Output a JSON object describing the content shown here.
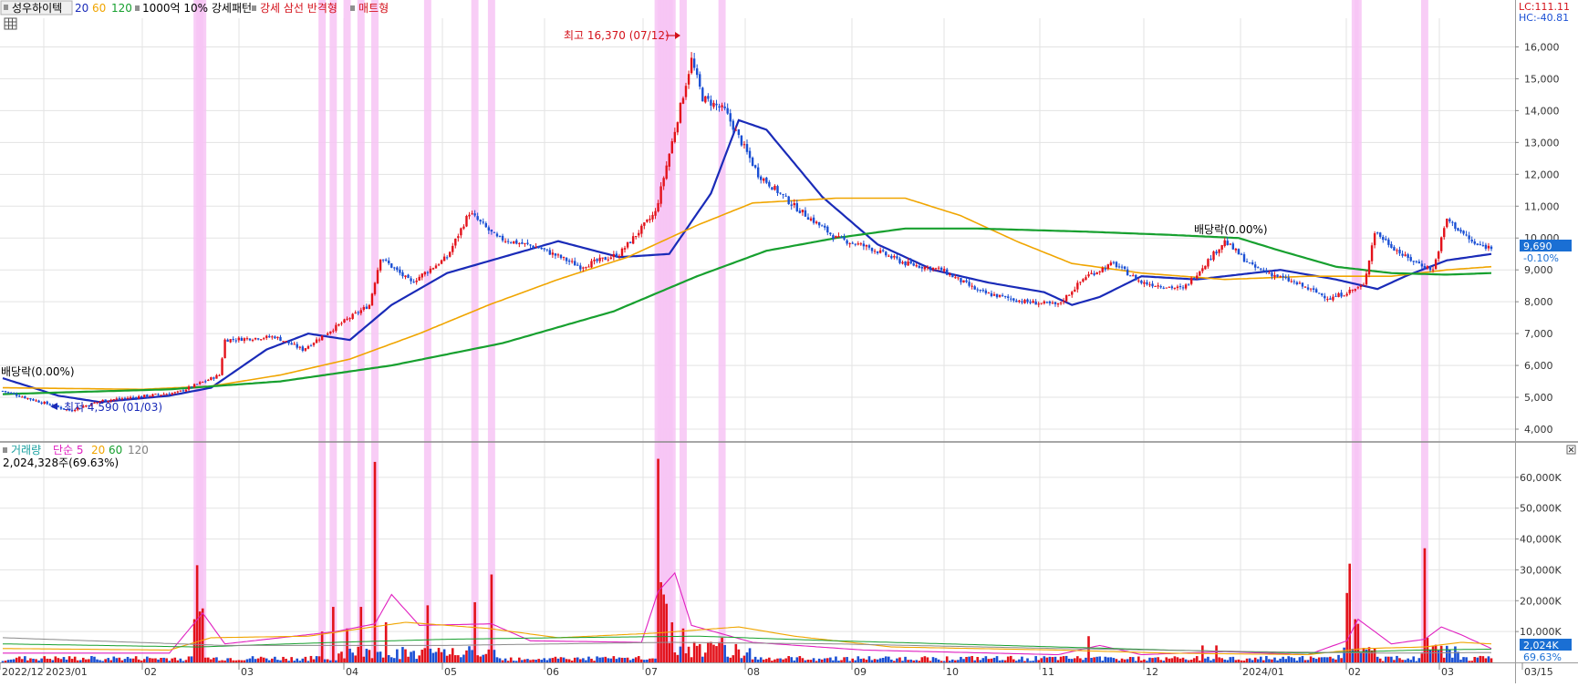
{
  "header": {
    "stock_name": "성우하이텍",
    "ma_labels": [
      {
        "label": "20",
        "color": "#1a2bb8"
      },
      {
        "label": "60",
        "color": "#f0a500"
      },
      {
        "label": "120",
        "color": "#17a02f"
      }
    ],
    "filter_text": "1000억 10% 강세패턴",
    "pattern_labels": [
      {
        "label": "강세 삼선 반격형",
        "color": "#d4121b"
      },
      {
        "label": "매트형",
        "color": "#d4121b"
      }
    ],
    "lc_text": "LC:111.11",
    "hc_text": "HC:-40.81"
  },
  "price_panel": {
    "current_price": "9,690",
    "change_pct": "-0.10%",
    "high_annotation": "최고 16,370 (07/12)",
    "low_annotation": "최저 4,590 (01/03)",
    "dividend_labels": [
      "배당락(0.00%)",
      "배당락(0.00%)"
    ]
  },
  "volume_panel": {
    "legend": [
      {
        "label": "거래량",
        "color": "#1aa0a0"
      },
      {
        "label": "단순 5",
        "color": "#e020c0"
      },
      {
        "label": "20",
        "color": "#f0a500"
      },
      {
        "label": "60",
        "color": "#17a02f"
      },
      {
        "label": "120",
        "color": "#808080"
      }
    ],
    "volume_text": "2,024,328주(69.63%)",
    "current_volume": "2,024K",
    "current_ratio": "69.63%"
  },
  "chart_data": [
    {
      "type": "candlestick",
      "title": "성우하이텍",
      "x_labels": [
        "2022/12",
        "2023/01",
        "02",
        "03",
        "04",
        "05",
        "06",
        "07",
        "08",
        "09",
        "10",
        "11",
        "12",
        "2024/01",
        "02",
        "03",
        "03/15"
      ],
      "y_ticks": [
        "4,000",
        "5,000",
        "6,000",
        "7,000",
        "8,000",
        "9,000",
        "10,000",
        "11,000",
        "12,000",
        "13,000",
        "14,000",
        "15,000",
        "16,000"
      ],
      "ylim": [
        3600,
        16900
      ],
      "price_path": [
        [
          0,
          5200
        ],
        [
          24,
          4590
        ],
        [
          36,
          4900
        ],
        [
          63,
          5150
        ],
        [
          78,
          5700
        ],
        [
          80,
          6800
        ],
        [
          98,
          6900
        ],
        [
          108,
          6500
        ],
        [
          118,
          7100
        ],
        [
          132,
          7900
        ],
        [
          136,
          9400
        ],
        [
          147,
          8600
        ],
        [
          160,
          9400
        ],
        [
          168,
          10800
        ],
        [
          178,
          10000
        ],
        [
          193,
          9700
        ],
        [
          208,
          9100
        ],
        [
          222,
          9500
        ],
        [
          235,
          10800
        ],
        [
          248,
          15600
        ],
        [
          252,
          14400
        ],
        [
          260,
          14000
        ],
        [
          272,
          12000
        ],
        [
          285,
          11000
        ],
        [
          300,
          10000
        ],
        [
          312,
          9700
        ],
        [
          325,
          9200
        ],
        [
          338,
          9000
        ],
        [
          352,
          8300
        ],
        [
          368,
          8000
        ],
        [
          380,
          7900
        ],
        [
          390,
          8800
        ],
        [
          400,
          9200
        ],
        [
          410,
          8600
        ],
        [
          425,
          8400
        ],
        [
          440,
          9900
        ],
        [
          450,
          9100
        ],
        [
          465,
          8600
        ],
        [
          478,
          8100
        ],
        [
          490,
          8500
        ],
        [
          494,
          10200
        ],
        [
          505,
          9400
        ],
        [
          515,
          9000
        ],
        [
          520,
          10600
        ],
        [
          530,
          9800
        ],
        [
          536,
          9700
        ]
      ],
      "ma": [
        {
          "name": "20",
          "color": "#1a2bb8",
          "points": [
            [
              0,
              5600
            ],
            [
              20,
              5050
            ],
            [
              35,
              4850
            ],
            [
              60,
              5050
            ],
            [
              75,
              5300
            ],
            [
              95,
              6500
            ],
            [
              110,
              7000
            ],
            [
              125,
              6800
            ],
            [
              140,
              7900
            ],
            [
              160,
              8900
            ],
            [
              180,
              9400
            ],
            [
              200,
              9900
            ],
            [
              222,
              9400
            ],
            [
              240,
              9500
            ],
            [
              255,
              11400
            ],
            [
              265,
              13700
            ],
            [
              275,
              13400
            ],
            [
              295,
              11300
            ],
            [
              315,
              9800
            ],
            [
              335,
              9000
            ],
            [
              355,
              8600
            ],
            [
              375,
              8300
            ],
            [
              385,
              7900
            ],
            [
              395,
              8150
            ],
            [
              410,
              8800
            ],
            [
              430,
              8700
            ],
            [
              460,
              9000
            ],
            [
              480,
              8700
            ],
            [
              495,
              8400
            ],
            [
              505,
              8800
            ],
            [
              520,
              9300
            ],
            [
              536,
              9500
            ]
          ]
        },
        {
          "name": "60",
          "color": "#f0a500",
          "points": [
            [
              0,
              5300
            ],
            [
              50,
              5250
            ],
            [
              75,
              5350
            ],
            [
              100,
              5700
            ],
            [
              125,
              6200
            ],
            [
              150,
              7000
            ],
            [
              175,
              7900
            ],
            [
              200,
              8700
            ],
            [
              225,
              9400
            ],
            [
              250,
              10400
            ],
            [
              270,
              11100
            ],
            [
              300,
              11250
            ],
            [
              325,
              11250
            ],
            [
              345,
              10700
            ],
            [
              365,
              9900
            ],
            [
              385,
              9200
            ],
            [
              410,
              8900
            ],
            [
              440,
              8700
            ],
            [
              470,
              8800
            ],
            [
              500,
              8800
            ],
            [
              520,
              9000
            ],
            [
              536,
              9100
            ]
          ]
        },
        {
          "name": "120",
          "color": "#17a02f",
          "points": [
            [
              0,
              5100
            ],
            [
              60,
              5250
            ],
            [
              100,
              5500
            ],
            [
              140,
              6000
            ],
            [
              180,
              6700
            ],
            [
              220,
              7700
            ],
            [
              250,
              8800
            ],
            [
              275,
              9600
            ],
            [
              300,
              10000
            ],
            [
              325,
              10300
            ],
            [
              350,
              10300
            ],
            [
              390,
              10200
            ],
            [
              420,
              10100
            ],
            [
              445,
              10000
            ],
            [
              460,
              9600
            ],
            [
              480,
              9100
            ],
            [
              500,
              8900
            ],
            [
              520,
              8850
            ],
            [
              536,
              8900
            ]
          ]
        }
      ],
      "highlight_bars": [
        70,
        71,
        72,
        115,
        119,
        124,
        129,
        134,
        153,
        170,
        176,
        236,
        237,
        238,
        239,
        240,
        241,
        245,
        259,
        487,
        488,
        512
      ]
    },
    {
      "type": "bar",
      "title": "거래량",
      "y_ticks": [
        "10,000K",
        "20,000K",
        "30,000K",
        "40,000K",
        "50,000K",
        "60,000K"
      ],
      "ylim": [
        0,
        70000
      ],
      "spikes_k": [
        [
          69,
          14000
        ],
        [
          70,
          31500
        ],
        [
          71,
          16500
        ],
        [
          72,
          17500
        ],
        [
          115,
          10000
        ],
        [
          119,
          18000
        ],
        [
          124,
          11000
        ],
        [
          129,
          18000
        ],
        [
          134,
          65000
        ],
        [
          138,
          13000
        ],
        [
          153,
          18500
        ],
        [
          170,
          19500
        ],
        [
          176,
          28500
        ],
        [
          236,
          66000
        ],
        [
          237,
          26000
        ],
        [
          238,
          22000
        ],
        [
          239,
          19000
        ],
        [
          241,
          13000
        ],
        [
          245,
          11000
        ],
        [
          259,
          8000
        ],
        [
          391,
          8500
        ],
        [
          432,
          5500
        ],
        [
          437,
          5500
        ],
        [
          484,
          22500
        ],
        [
          485,
          32000
        ],
        [
          487,
          14000
        ],
        [
          488,
          12500
        ],
        [
          512,
          37000
        ],
        [
          513,
          8000
        ]
      ],
      "ma5_points": [
        [
          0,
          3000
        ],
        [
          60,
          3000
        ],
        [
          72,
          16000
        ],
        [
          80,
          6000
        ],
        [
          120,
          10000
        ],
        [
          134,
          12500
        ],
        [
          140,
          22000
        ],
        [
          150,
          12000
        ],
        [
          176,
          12500
        ],
        [
          190,
          7000
        ],
        [
          230,
          6500
        ],
        [
          236,
          23000
        ],
        [
          242,
          29000
        ],
        [
          248,
          12000
        ],
        [
          270,
          6500
        ],
        [
          310,
          4000
        ],
        [
          380,
          2500
        ],
        [
          395,
          5500
        ],
        [
          410,
          2500
        ],
        [
          440,
          3500
        ],
        [
          470,
          2500
        ],
        [
          484,
          7000
        ],
        [
          488,
          14000
        ],
        [
          500,
          6000
        ],
        [
          512,
          7500
        ],
        [
          518,
          11500
        ],
        [
          525,
          9000
        ],
        [
          536,
          4500
        ]
      ],
      "ma20_points": [
        [
          0,
          4500
        ],
        [
          60,
          4000
        ],
        [
          75,
          8000
        ],
        [
          110,
          8500
        ],
        [
          145,
          13000
        ],
        [
          175,
          11000
        ],
        [
          200,
          8000
        ],
        [
          235,
          9500
        ],
        [
          265,
          11500
        ],
        [
          285,
          8500
        ],
        [
          320,
          5000
        ],
        [
          380,
          4000
        ],
        [
          420,
          3000
        ],
        [
          470,
          2500
        ],
        [
          490,
          4500
        ],
        [
          512,
          5000
        ],
        [
          525,
          6500
        ],
        [
          536,
          6000
        ]
      ],
      "ma60_points": [
        [
          0,
          6000
        ],
        [
          70,
          5000
        ],
        [
          120,
          6500
        ],
        [
          160,
          7500
        ],
        [
          200,
          8000
        ],
        [
          250,
          8500
        ],
        [
          300,
          7000
        ],
        [
          360,
          5500
        ],
        [
          420,
          4000
        ],
        [
          470,
          3000
        ],
        [
          510,
          4000
        ],
        [
          536,
          4300
        ]
      ],
      "ma120_points": [
        [
          0,
          8000
        ],
        [
          80,
          5500
        ],
        [
          160,
          5500
        ],
        [
          240,
          6500
        ],
        [
          300,
          6000
        ],
        [
          380,
          4500
        ],
        [
          450,
          3500
        ],
        [
          500,
          3000
        ],
        [
          536,
          3200
        ]
      ]
    }
  ]
}
